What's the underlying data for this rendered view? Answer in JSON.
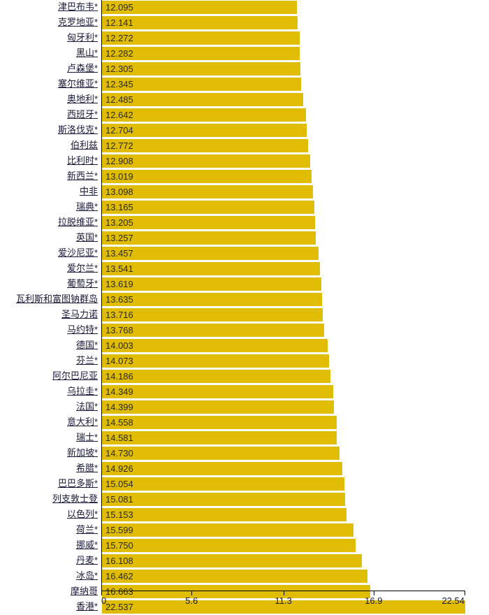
{
  "chart_data": {
    "type": "bar",
    "orientation": "horizontal",
    "title": "",
    "subtitle": "",
    "xlabel": "",
    "ylabel": "",
    "grid": false,
    "legend": null,
    "xlim": [
      0,
      22.537
    ],
    "axis_ticks": [
      "0",
      "5.6",
      "11.3",
      "16.9",
      "22.54"
    ],
    "axis_tick_values": [
      0,
      5.6,
      11.3,
      16.9,
      22.54
    ],
    "value_label_format": "3 decimals",
    "bar_color": "#e0bc05",
    "label_color": "#1b1b3a",
    "categories": [
      "津巴布韦*",
      "克罗地亚*",
      "匈牙利*",
      "黑山*",
      "卢森堡*",
      "塞尔维亚*",
      "奥地利*",
      "西班牙*",
      "斯洛伐克*",
      "伯利兹",
      "比利时*",
      "新西兰*",
      "中非",
      "瑞典*",
      "拉脱维亚*",
      "英国*",
      "爱沙尼亚*",
      "爱尔兰*",
      "葡萄牙*",
      "瓦利斯和富图钠群岛",
      "圣马力诺",
      "马约特*",
      "德国*",
      "芬兰*",
      "阿尔巴尼亚",
      "乌拉圭*",
      "法国*",
      "意大利*",
      "瑞士*",
      "新加坡*",
      "希腊*",
      "巴巴多斯*",
      "列支敦士登",
      "以色列*",
      "荷兰*",
      "挪威*",
      "丹麦*",
      "冰岛*",
      "摩纳哥",
      "香港*"
    ],
    "values": [
      12.095,
      12.141,
      12.272,
      12.282,
      12.305,
      12.345,
      12.485,
      12.642,
      12.704,
      12.772,
      12.908,
      13.019,
      13.098,
      13.165,
      13.205,
      13.257,
      13.457,
      13.541,
      13.619,
      13.635,
      13.716,
      13.768,
      14.003,
      14.073,
      14.186,
      14.349,
      14.399,
      14.558,
      14.581,
      14.73,
      14.926,
      15.054,
      15.081,
      15.153,
      15.599,
      15.75,
      16.108,
      16.462,
      16.663,
      22.537
    ],
    "value_labels": [
      "12.095",
      "12.141",
      "12.272",
      "12.282",
      "12.305",
      "12.345",
      "12.485",
      "12.642",
      "12.704",
      "12.772",
      "12.908",
      "13.019",
      "13.098",
      "13.165",
      "13.205",
      "13.257",
      "13.457",
      "13.541",
      "13.619",
      "13.635",
      "13.716",
      "13.768",
      "14.003",
      "14.073",
      "14.186",
      "14.349",
      "14.399",
      "14.558",
      "14.581",
      "14.730",
      "14.926",
      "15.054",
      "15.081",
      "15.153",
      "15.599",
      "15.750",
      "16.108",
      "16.462",
      "16.663",
      "22.537"
    ]
  }
}
